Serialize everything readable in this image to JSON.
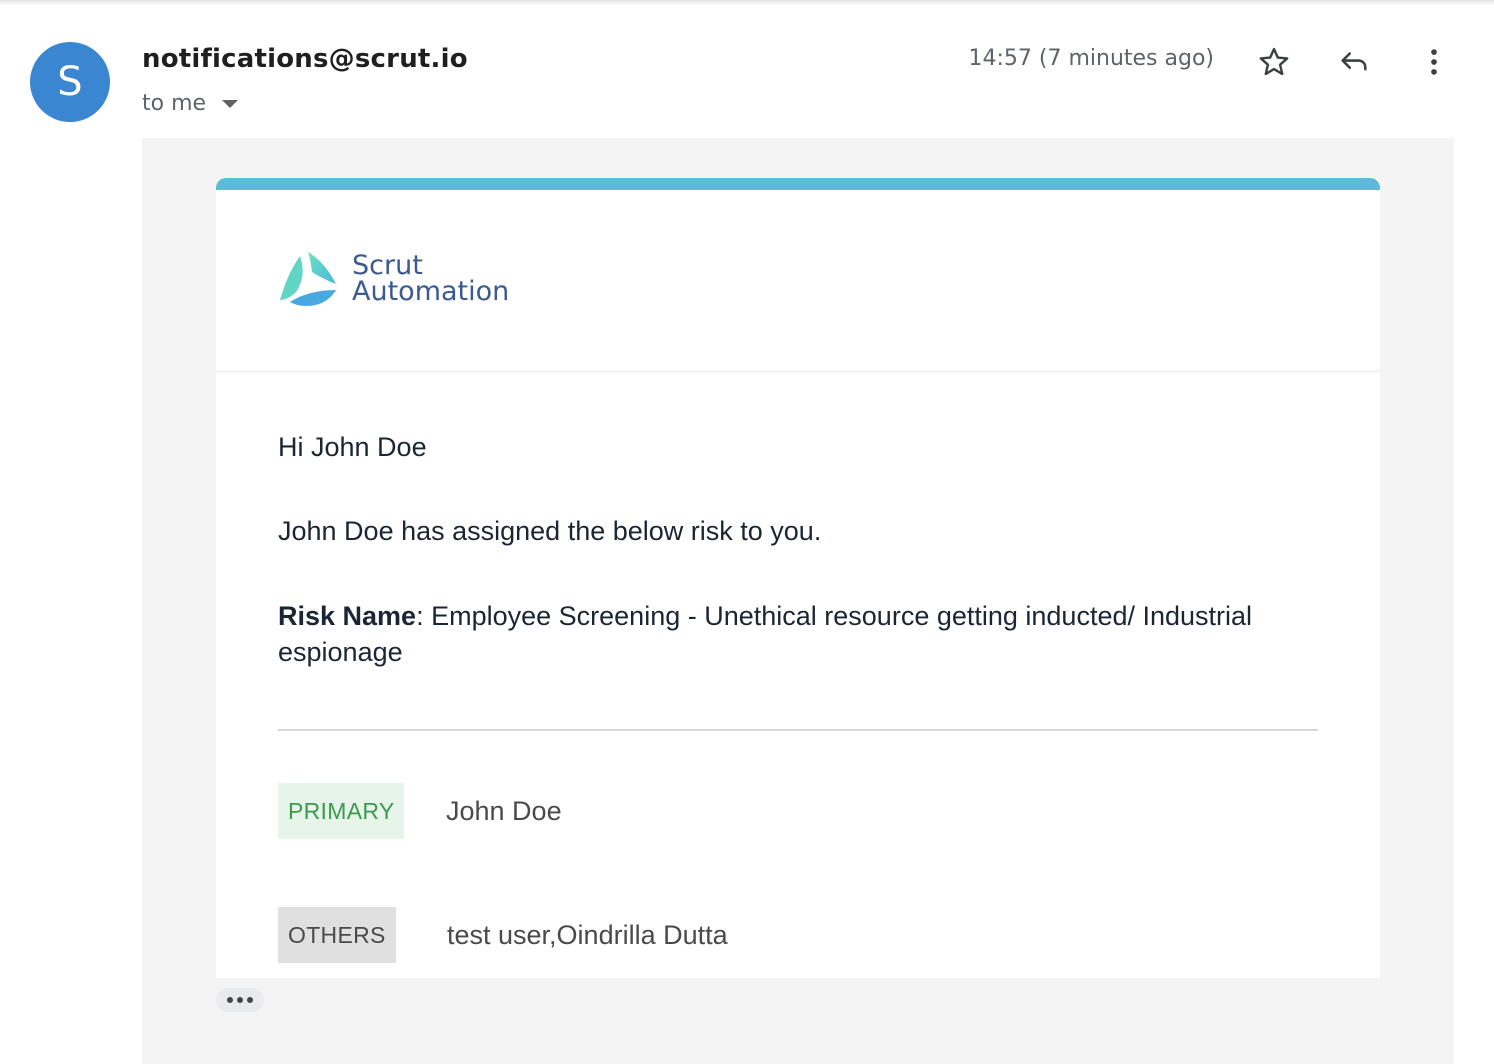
{
  "sender": {
    "avatar_letter": "S",
    "email": "notifications@scrut.io",
    "recipient_label": "to me"
  },
  "message": {
    "timestamp": "14:57 (7 minutes ago)"
  },
  "actions": {
    "star_icon": "star-outline-icon",
    "reply_icon": "reply-icon",
    "more_icon": "more-vert-icon"
  },
  "email_card": {
    "accent_color": "#5bbcd9",
    "logo": {
      "line1": "Scrut",
      "line2": "Automation"
    },
    "greeting": "Hi John Doe",
    "assignment_text": "John Doe has assigned the below risk to you.",
    "risk_label": "Risk Name",
    "risk_value": ": Employee Screening - Unethical resource getting inducted/ Industrial espionage",
    "primary": {
      "tag": "PRIMARY",
      "name": "John Doe"
    },
    "others": {
      "tag": "OTHERS",
      "names": "test user,Oindrilla Dutta"
    }
  },
  "colors": {
    "avatar_bg": "#3a86d1",
    "primary_tag_bg": "#e6f4ea",
    "primary_tag_text": "#3c9a4e",
    "others_tag_bg": "#e0e0e0"
  }
}
